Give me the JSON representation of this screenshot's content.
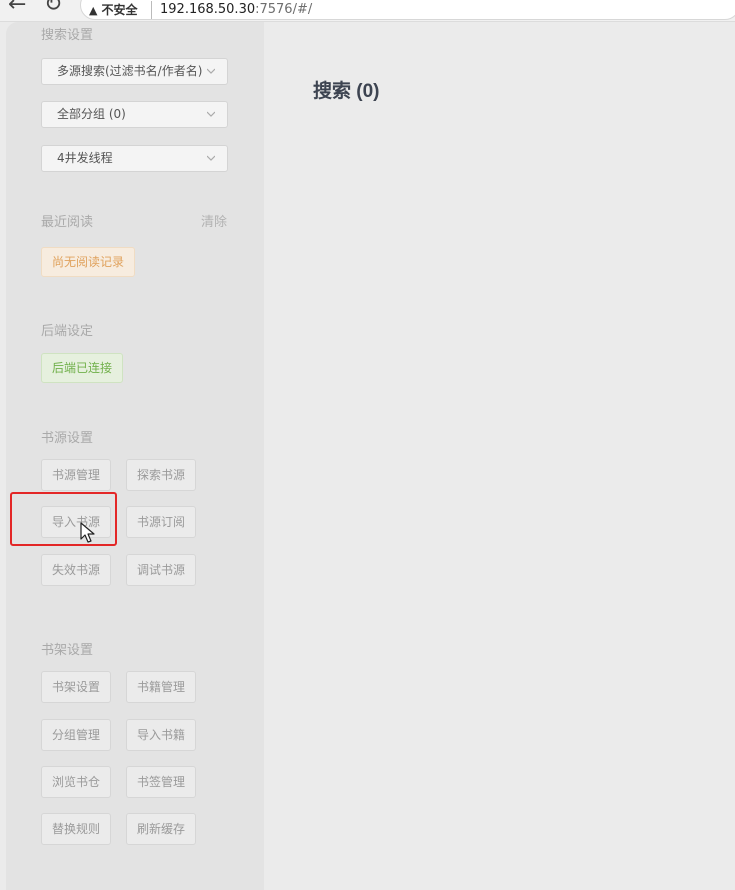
{
  "browser": {
    "back_icon": "arrow-left-icon",
    "reload_icon": "reload-icon",
    "security_label": "不安全",
    "url_host": "192.168.50.30",
    "url_rest": ":7576/#/"
  },
  "sidebar": {
    "search_settings": {
      "title": "搜索设置",
      "source_select": "多源搜索(过滤书名/作者名)",
      "group_select": "全部分组 (0)",
      "thread_select": "4井发线程"
    },
    "recent": {
      "title": "最近阅读",
      "clear_label": "清除",
      "empty_tag": "尚无阅读记录"
    },
    "backend": {
      "title": "后端设定",
      "status_tag": "后端已连接"
    },
    "source_settings": {
      "title": "书源设置",
      "buttons": [
        "书源管理",
        "探索书源",
        "导入书源",
        "书源订阅",
        "失效书源",
        "调试书源"
      ]
    },
    "shelf_settings": {
      "title": "书架设置",
      "buttons": [
        "书架设置",
        "书籍管理",
        "分组管理",
        "导入书籍",
        "浏览书仓",
        "书签管理",
        "替换规则",
        "刷新缓存"
      ]
    }
  },
  "main": {
    "title": "搜索 (0)"
  },
  "colors": {
    "highlight": "#e32727",
    "warn_tag": "#e0a25d",
    "ok_tag": "#71b04b"
  }
}
